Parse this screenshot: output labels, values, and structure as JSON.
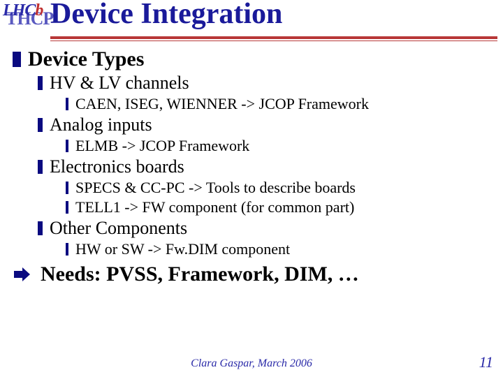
{
  "header": {
    "logo_back": "THCP",
    "logo_front_1": "LHC",
    "logo_front_2": "b",
    "title": "Device Integration"
  },
  "content": {
    "section": "Device Types",
    "items": [
      {
        "label": "HV & LV channels",
        "sub": [
          "CAEN, ISEG, WIENNER -> JCOP Framework"
        ]
      },
      {
        "label": "Analog inputs",
        "sub": [
          "ELMB -> JCOP Framework"
        ]
      },
      {
        "label": "Electronics boards",
        "sub": [
          "SPECS & CC-PC -> Tools to describe boards",
          "TELL1 -> FW component (for common part)"
        ]
      },
      {
        "label": "Other Components",
        "sub": [
          "HW or SW -> Fw.DIM component"
        ]
      }
    ],
    "conclusion": "Needs: PVSS, Framework, DIM, …"
  },
  "footer": {
    "credit": "Clara Gaspar, March 2006",
    "page": "11"
  }
}
